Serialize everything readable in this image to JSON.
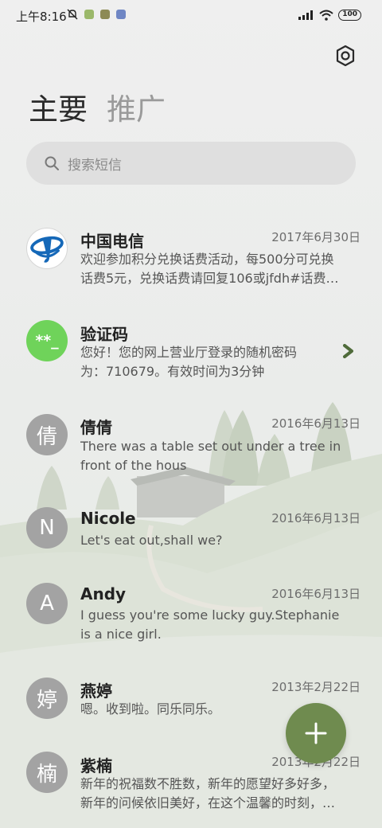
{
  "status_bar": {
    "time": "上午8:16",
    "battery": "100"
  },
  "tabs": [
    {
      "label": "主要",
      "active": true
    },
    {
      "label": "推广",
      "active": false
    }
  ],
  "search": {
    "placeholder": "搜索短信"
  },
  "conversations": [
    {
      "sender": "中国电信",
      "date": "2017年6月30日",
      "preview_lines": [
        "欢迎参加积分兑换话费活动，每500分可兑换",
        "话费5元，兑换话费请回复106或jfdh#话费…"
      ],
      "avatar": "china-telecom-logo"
    },
    {
      "sender": "验证码",
      "date": "",
      "preview_lines": [
        "您好！您的网上营业厅登录的随机密码",
        "为：710679。有效时间为3分钟"
      ],
      "avatar_text": "**_"
    },
    {
      "sender": "倩倩",
      "date": "2016年6月13日",
      "preview_lines": [
        "There was a table set out under a tree in",
        "front of the hous"
      ],
      "avatar_text": "倩"
    },
    {
      "sender": "Nicole",
      "date": "2016年6月13日",
      "preview_lines": [
        "Let's eat out,shall we?"
      ],
      "avatar_text": "N"
    },
    {
      "sender": "Andy",
      "date": "2016年6月13日",
      "preview_lines": [
        "I guess you're some lucky guy.Stephanie",
        "is a nice girl."
      ],
      "avatar_text": "A"
    },
    {
      "sender": "燕婷",
      "date": "2013年2月22日",
      "preview_lines": [
        "嗯。收到啦。同乐同乐。"
      ],
      "avatar_text": "婷"
    },
    {
      "sender": "紫楠",
      "date": "2013年2月22日",
      "preview_lines": [
        "新年的祝福数不胜数，新年的愿望好多好多，",
        "新年的问候依旧美好，在这个温馨的时刻，…"
      ],
      "avatar_text": "楠"
    }
  ],
  "colors": {
    "accent": "#6f8b4f",
    "verify_avatar": "#6fd35a",
    "avatar_gray": "#a3a3a3"
  }
}
